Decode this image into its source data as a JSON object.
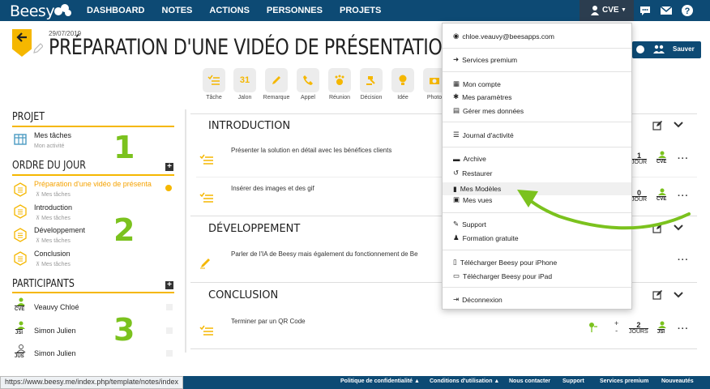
{
  "app": {
    "logo": "Beesy"
  },
  "nav": {
    "items": [
      "DASHBOARD",
      "NOTES",
      "ACTIONS",
      "PERSONNES",
      "PROJETS"
    ],
    "user_initials": "CVE"
  },
  "header": {
    "date": "29/07/2019",
    "title": "PRÉPARATION D'UNE VIDÉO DE PRÉSENTATION",
    "save_label": "Sauver"
  },
  "tools": [
    "Tâche",
    "Jalon",
    "Remarque",
    "Appel",
    "Réunion",
    "Décision",
    "Idée",
    "Photo"
  ],
  "sidebar": {
    "projet_title": "PROJET",
    "projet_item": "Mes tâches",
    "projet_sub": "Mon activité",
    "ordre_title": "ORDRE DU JOUR",
    "ordre_items": [
      {
        "label": "Préparation d'une vidéo de présenta",
        "sub": "Mes tâches"
      },
      {
        "label": "Introduction",
        "sub": "Mes tâches"
      },
      {
        "label": "Développement",
        "sub": "Mes tâches"
      },
      {
        "label": "Conclusion",
        "sub": "Mes tâches"
      }
    ],
    "participants_title": "PARTICIPANTS",
    "participants": [
      {
        "initials": "CVE",
        "name": "Veauvy Chloé"
      },
      {
        "initials": "JSI",
        "name": "Simon Julien"
      },
      {
        "initials": "JUS",
        "name": "Simon Julien"
      }
    ]
  },
  "steps": [
    "1",
    "2",
    "3"
  ],
  "sections": [
    {
      "title": "INTRODUCTION",
      "tasks": [
        {
          "text": "Présenter la solution en détail avec les bénéfices clients",
          "count": "1",
          "unit": "JOUR",
          "owner": "CVE"
        },
        {
          "text": "Insérer des images et des gif",
          "count": "0",
          "unit": "JOUR",
          "owner": "CVE"
        }
      ]
    },
    {
      "title": "DÉVELOPPEMENT",
      "tasks": [
        {
          "text": "Parler de l'IA de Beesy mais également du fonctionnement de Be"
        }
      ]
    },
    {
      "title": "CONCLUSION",
      "tasks": [
        {
          "text": "Terminer par un QR Code",
          "count": "2",
          "unit": "JOURS",
          "owner": "JSI"
        }
      ]
    }
  ],
  "dropdown": {
    "email": "chloe.veauvy@beesapps.com",
    "items": [
      "Services premium",
      "Mon compte",
      "Mes paramètres",
      "Gérer mes données",
      "Journal d'activité",
      "Archive",
      "Restaurer",
      "Mes Modèles",
      "Mes vues",
      "Support",
      "Formation gratuite",
      "Télécharger Beesy pour iPhone",
      "Télécharger Beesy pour iPad",
      "Déconnexion"
    ]
  },
  "footer": {
    "status_url": "https://www.beesy.me/index.php/template/notes/index",
    "links": [
      "Politique de confidentialité ▲",
      "Conditions d'utilisation ▲",
      "Nous contacter",
      "Support",
      "Services premium",
      "Nouveautés"
    ]
  },
  "colors": {
    "nav": "#0d4a74",
    "accent": "#f5b700",
    "green": "#7bc21e"
  }
}
